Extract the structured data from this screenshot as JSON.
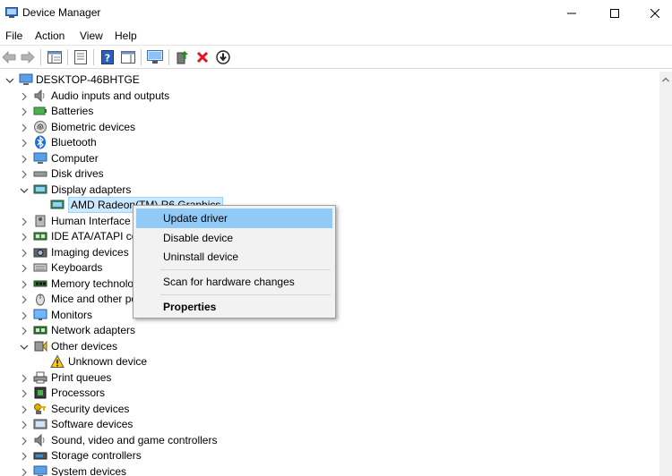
{
  "window": {
    "title": "Device Manager"
  },
  "menu": [
    "File",
    "Action",
    "View",
    "Help"
  ],
  "tree": {
    "root": "DESKTOP-46BHTGE",
    "items": [
      {
        "label": "Audio inputs and outputs",
        "icon": "speaker-icon"
      },
      {
        "label": "Batteries",
        "icon": "battery-icon"
      },
      {
        "label": "Biometric devices",
        "icon": "fingerprint-icon"
      },
      {
        "label": "Bluetooth",
        "icon": "bluetooth-icon"
      },
      {
        "label": "Computer",
        "icon": "computer-icon"
      },
      {
        "label": "Disk drives",
        "icon": "disk-drive-icon"
      },
      {
        "label": "Display adapters",
        "icon": "display-adapter-icon",
        "expanded": true
      },
      {
        "label": "AMD Radeon(TM) R6 Graphics",
        "icon": "display-adapter-icon",
        "child": true,
        "selected": true
      },
      {
        "label": "Human Interface Devices",
        "icon": "hid-icon"
      },
      {
        "label": "IDE ATA/ATAPI controllers",
        "icon": "ide-controller-icon"
      },
      {
        "label": "Imaging devices",
        "icon": "camera-icon"
      },
      {
        "label": "Keyboards",
        "icon": "keyboard-icon"
      },
      {
        "label": "Memory technology devices",
        "icon": "memory-icon"
      },
      {
        "label": "Mice and other pointing devices",
        "icon": "mouse-icon"
      },
      {
        "label": "Monitors",
        "icon": "monitor-icon"
      },
      {
        "label": "Network adapters",
        "icon": "network-icon"
      },
      {
        "label": "Other devices",
        "icon": "other-devices-icon",
        "expanded": true
      },
      {
        "label": "Unknown device",
        "icon": "warning-icon",
        "child": true
      },
      {
        "label": "Print queues",
        "icon": "printer-icon"
      },
      {
        "label": "Processors",
        "icon": "processor-icon"
      },
      {
        "label": "Security devices",
        "icon": "key-icon"
      },
      {
        "label": "Software devices",
        "icon": "software-device-icon"
      },
      {
        "label": "Sound, video and game controllers",
        "icon": "speaker-icon"
      },
      {
        "label": "Storage controllers",
        "icon": "storage-icon"
      },
      {
        "label": "System devices",
        "icon": "computer-icon"
      }
    ]
  },
  "context_menu": {
    "update_driver": "Update driver",
    "disable_device": "Disable device",
    "uninstall_device": "Uninstall device",
    "scan_hardware": "Scan for hardware changes",
    "properties": "Properties"
  },
  "colors": {
    "selection_bg": "#cce8ff",
    "menu_highlight": "#91c9f7",
    "remove_red": "#e81123",
    "accent_green": "#2a8a2a"
  }
}
